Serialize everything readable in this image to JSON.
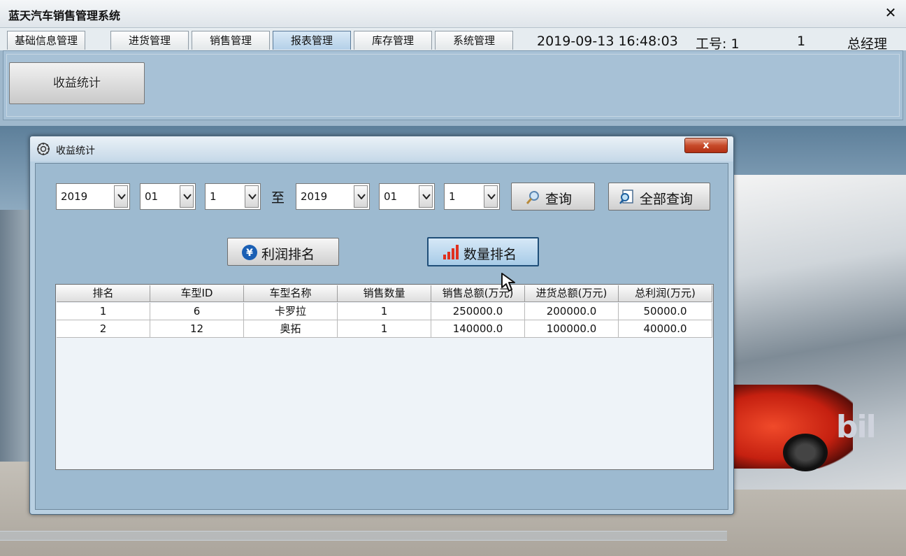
{
  "app": {
    "title": "蓝天汽车销售管理系统",
    "close_glyph": "✕"
  },
  "tabs": [
    {
      "label": "基础信息管理"
    },
    {
      "label": "进货管理"
    },
    {
      "label": "销售管理"
    },
    {
      "label": "报表管理",
      "active": true
    },
    {
      "label": "库存管理"
    },
    {
      "label": "系统管理"
    }
  ],
  "status": {
    "datetime": "2019-09-13 16:48:03",
    "employee_id": "工号: 1",
    "user": "1",
    "role": "总经理"
  },
  "ribbon": {
    "button_label": "收益统计"
  },
  "scene": {
    "sign_text": "bil"
  },
  "dialog": {
    "title": "收益统计",
    "close_glyph": "x",
    "filters": {
      "from_year": "2019",
      "from_month": "01",
      "from_day": "1",
      "to_label": "至",
      "to_year": "2019",
      "to_month": "01",
      "to_day": "1"
    },
    "buttons": {
      "query": "查询",
      "query_all": "全部查询",
      "profit_rank": "利润排名",
      "quantity_rank": "数量排名"
    },
    "table": {
      "columns": [
        "排名",
        "车型ID",
        "车型名称",
        "销售数量",
        "销售总额(万元)",
        "进货总额(万元)",
        "总利润(万元)"
      ],
      "rows": [
        [
          "1",
          "6",
          "卡罗拉",
          "1",
          "250000.0",
          "200000.0",
          "50000.0"
        ],
        [
          "2",
          "12",
          "奥拓",
          "1",
          "140000.0",
          "100000.0",
          "40000.0"
        ]
      ]
    }
  },
  "colors": {
    "accent_active_tab": "#b4d0e8",
    "dialog_body": "#9dbad0",
    "close_button": "#c74a2a",
    "chart_icon_red": "#e0301e",
    "yen_icon_blue": "#1a5fb4"
  },
  "icons": [
    "close-icon",
    "gear-icon",
    "chevron-down-icon",
    "magnifier-icon",
    "search-document-icon",
    "yen-icon",
    "bar-chart-icon",
    "cursor-icon"
  ]
}
